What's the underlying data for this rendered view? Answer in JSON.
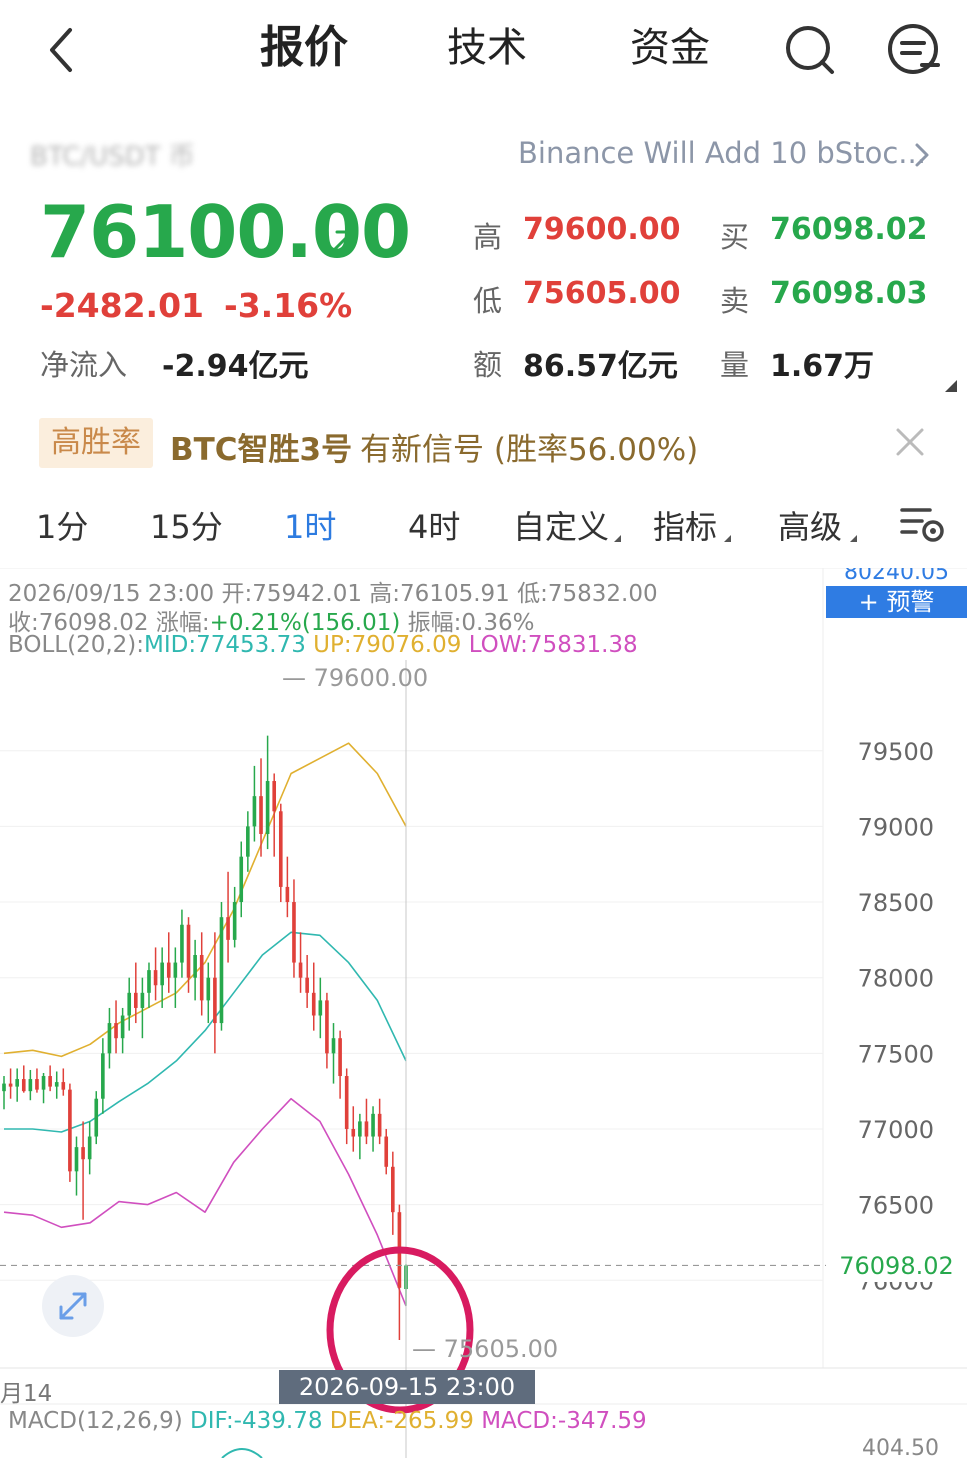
{
  "nav": {
    "back_icon": "chevron-left-icon",
    "tabs": [
      {
        "label": "报价",
        "active": true
      },
      {
        "label": "技术",
        "active": false
      },
      {
        "label": "资金",
        "active": false
      }
    ],
    "search_icon": "search-icon",
    "menu_icon": "chat-menu-icon"
  },
  "header": {
    "pair_blurred": "BTC/USDT 币",
    "news": "Binance Will Add 10 bStoc...",
    "price": "76100.00",
    "change": "-2482.01",
    "change_pct": "-3.16%",
    "netflow_label": "净流入",
    "netflow_value": "-2.94亿元",
    "high_label": "高",
    "high_value": "79600.00",
    "low_label": "低",
    "low_value": "75605.00",
    "amount_label": "额",
    "amount_value": "86.57亿元",
    "buy_label": "买",
    "buy_value": "76098.02",
    "sell_label": "卖",
    "sell_value": "76098.03",
    "volume_label": "量",
    "volume_value": "1.67万"
  },
  "signal": {
    "badge": "高胜率",
    "name": "BTC智胜3号",
    "text": "有新信号 (胜率56.00%)"
  },
  "periods": {
    "items": [
      {
        "label": "1分",
        "active": false,
        "dropdown": false
      },
      {
        "label": "15分",
        "active": false,
        "dropdown": false
      },
      {
        "label": "1时",
        "active": true,
        "dropdown": false
      },
      {
        "label": "4时",
        "active": false,
        "dropdown": false
      },
      {
        "label": "自定义",
        "active": false,
        "dropdown": true
      },
      {
        "label": "指标",
        "active": false,
        "dropdown": true
      },
      {
        "label": "高级",
        "active": false,
        "dropdown": true
      }
    ],
    "settings_icon": "chart-settings-icon"
  },
  "chart_info": {
    "line1_time": "2026/09/15 23:00",
    "open_label": "开:",
    "open": "75942.01",
    "high_label": "高:",
    "high": "76105.91",
    "low_label": "低:",
    "low": "75832.00",
    "close_label": "收:",
    "close": "76098.02",
    "chg_label": "涨幅:",
    "chg": "+0.21%(156.01)",
    "amp_label": "振幅:",
    "amp": "0.36%",
    "boll_label": "BOLL(20,2):",
    "boll_mid": "MID:77453.73",
    "boll_up": "UP:79076.09",
    "boll_low": "LOW:75831.38",
    "alert_top": "80240.05",
    "alert_btn": "+ 预警",
    "max_label": "79600.00",
    "min_label": "75605.00",
    "last_price": "76098.02",
    "date_tag": "2026-09-15 23:00",
    "date_left": "月14",
    "macd_label": "MACD(12,26,9)",
    "dif": "DIF:-439.78",
    "dea": "DEA:-265.99",
    "macd": "MACD:-347.59",
    "macd_axis": "404.50"
  },
  "colors": {
    "up": "#27a84c",
    "down": "#e0403a",
    "accent": "#2d7be0",
    "boll_mid": "#30b8b0",
    "boll_up": "#e0b030",
    "boll_low": "#d04fbf",
    "annotation_circle": "#d81b60"
  },
  "chart_data": {
    "type": "candlestick",
    "y_ticks": [
      79500,
      79000,
      78500,
      78000,
      77500,
      77000,
      76500,
      76000
    ],
    "ylim": [
      75420,
      80100
    ],
    "candles": [
      [
        77250,
        77350,
        77130,
        77300
      ],
      [
        77300,
        77400,
        77200,
        77280
      ],
      [
        77280,
        77400,
        77180,
        77330
      ],
      [
        77330,
        77420,
        77240,
        77250
      ],
      [
        77250,
        77390,
        77190,
        77330
      ],
      [
        77330,
        77400,
        77240,
        77260
      ],
      [
        77260,
        77370,
        77170,
        77350
      ],
      [
        77350,
        77420,
        77250,
        77280
      ],
      [
        77280,
        77380,
        77200,
        77310
      ],
      [
        77310,
        77400,
        77220,
        77260
      ],
      [
        77260,
        77300,
        76650,
        76720
      ],
      [
        76720,
        76950,
        76560,
        76880
      ],
      [
        76880,
        77050,
        76400,
        76800
      ],
      [
        76800,
        77050,
        76700,
        76950
      ],
      [
        76950,
        77250,
        76900,
        77200
      ],
      [
        77200,
        77600,
        77100,
        77500
      ],
      [
        77500,
        77800,
        77400,
        77700
      ],
      [
        77700,
        77850,
        77500,
        77600
      ],
      [
        77600,
        77800,
        77500,
        77750
      ],
      [
        77750,
        78000,
        77650,
        77900
      ],
      [
        77900,
        78100,
        77700,
        77800
      ],
      [
        77800,
        78000,
        77600,
        77900
      ],
      [
        77900,
        78100,
        77800,
        78050
      ],
      [
        78050,
        78200,
        77850,
        77950
      ],
      [
        77950,
        78200,
        77800,
        78100
      ],
      [
        78100,
        78300,
        77900,
        78000
      ],
      [
        78000,
        78200,
        77800,
        78100
      ],
      [
        78100,
        78450,
        78000,
        78350
      ],
      [
        78350,
        78400,
        77900,
        78000
      ],
      [
        78000,
        78250,
        77850,
        78150
      ],
      [
        78150,
        78300,
        77750,
        77850
      ],
      [
        77850,
        78100,
        77700,
        78000
      ],
      [
        78000,
        78300,
        77500,
        77700
      ],
      [
        77700,
        78500,
        77650,
        78400
      ],
      [
        78400,
        78700,
        78100,
        78250
      ],
      [
        78250,
        78600,
        78200,
        78500
      ],
      [
        78500,
        78900,
        78400,
        78800
      ],
      [
        78800,
        79100,
        78700,
        79000
      ],
      [
        79000,
        79400,
        78900,
        79200
      ],
      [
        79200,
        79450,
        78800,
        78950
      ],
      [
        78950,
        79600,
        78850,
        79300
      ],
      [
        79300,
        79350,
        78800,
        79100
      ],
      [
        79100,
        79150,
        78500,
        78600
      ],
      [
        78600,
        78800,
        78400,
        78500
      ],
      [
        78500,
        78650,
        78000,
        78100
      ],
      [
        78100,
        78300,
        77900,
        78000
      ],
      [
        78000,
        78150,
        77800,
        77900
      ],
      [
        77900,
        78100,
        77650,
        77750
      ],
      [
        77750,
        78000,
        77600,
        77850
      ],
      [
        77850,
        77900,
        77400,
        77500
      ],
      [
        77500,
        77700,
        77300,
        77600
      ],
      [
        77600,
        77650,
        77200,
        77350
      ],
      [
        77350,
        77400,
        76900,
        77000
      ],
      [
        77000,
        77150,
        76850,
        76950
      ],
      [
        76950,
        77100,
        76800,
        77050
      ],
      [
        77050,
        77200,
        76900,
        76950
      ],
      [
        76950,
        77150,
        76850,
        77100
      ],
      [
        77100,
        77200,
        76900,
        76950
      ],
      [
        76950,
        77000,
        76700,
        76750
      ],
      [
        76750,
        76850,
        76300,
        76450
      ],
      [
        76450,
        76500,
        75605,
        75950
      ],
      [
        75942,
        76106,
        75832,
        76098
      ]
    ],
    "boll_up": [
      77500,
      77520,
      77480,
      77560,
      77700,
      77800,
      77900,
      78100,
      78450,
      78900,
      79350,
      79450,
      79550,
      79350,
      79000
    ],
    "boll_mid": [
      77000,
      77000,
      76980,
      77050,
      77180,
      77300,
      77450,
      77650,
      77900,
      78150,
      78300,
      78280,
      78100,
      77850,
      77450
    ],
    "boll_low": [
      76450,
      76430,
      76350,
      76380,
      76520,
      76500,
      76580,
      76450,
      76780,
      77000,
      77200,
      77050,
      76700,
      76300,
      75830
    ]
  }
}
